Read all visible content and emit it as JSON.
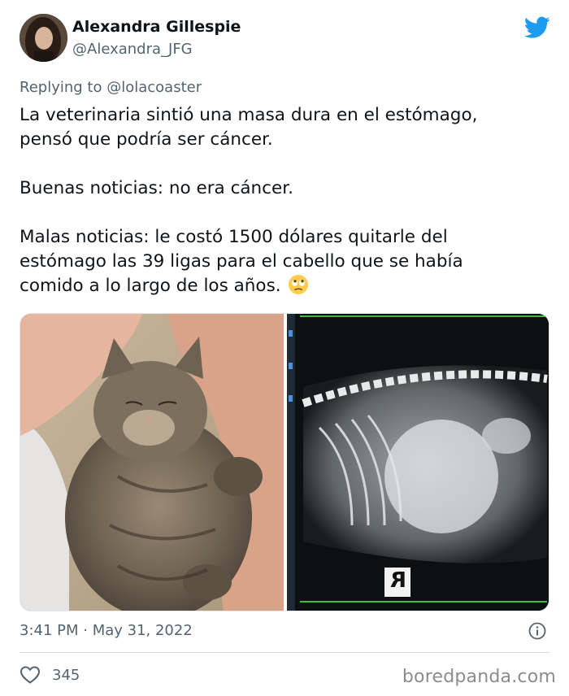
{
  "author": {
    "name": "Alexandra Gillespie",
    "handle": "@Alexandra_JFG"
  },
  "reply": {
    "prefix": "Replying to",
    "mention": "@lolacoaster"
  },
  "tweet": {
    "lines": [
      "La veterinaria sintió una masa dura en el estómago,",
      "pensó que podría ser cáncer.",
      "Buenas noticias: no era cáncer.",
      "Malas noticias: le costó 1500 dólares quitarle del",
      "estómago las 39 ligas para el cabello que se había",
      "comido a lo largo de los años."
    ],
    "emoji": "rolling-eyes-emoji"
  },
  "media": {
    "left": "cat-sleeping-photo",
    "right": "cat-xray-photo",
    "xray_marker": "R"
  },
  "meta": {
    "timestamp": "3:41 PM · May 31, 2022",
    "likes": "345"
  },
  "watermark": "boredpanda.com",
  "colors": {
    "twitter_blue": "#1d9bf0",
    "text": "#0f1419",
    "secondary": "#536471"
  },
  "icons": [
    "twitter-bird-icon",
    "info-icon",
    "heart-icon"
  ]
}
